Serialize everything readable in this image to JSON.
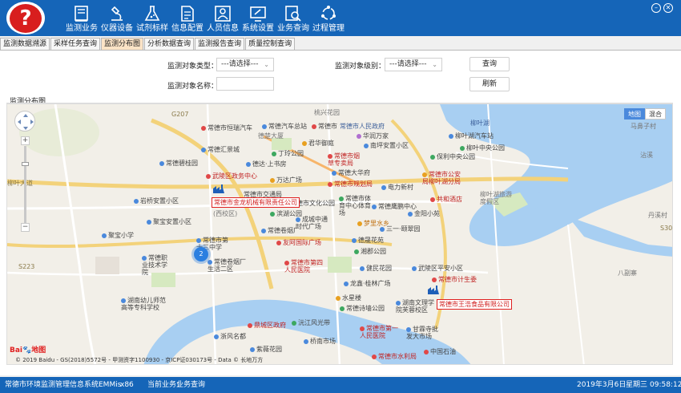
{
  "app": {
    "logo_char": "?",
    "window_min": "–",
    "window_close": "✕"
  },
  "toolbar": [
    {
      "label": "监测业务",
      "icon": "book-icon"
    },
    {
      "label": "仪器设备",
      "icon": "microscope-icon"
    },
    {
      "label": "试剂标样",
      "icon": "flask-icon"
    },
    {
      "label": "信息配置",
      "icon": "document-icon"
    },
    {
      "label": "人员信息",
      "icon": "person-card-icon"
    },
    {
      "label": "系统设置",
      "icon": "settings-screen-icon"
    },
    {
      "label": "业务查询",
      "icon": "search-doc-icon"
    },
    {
      "label": "过程管理",
      "icon": "cycle-icon"
    }
  ],
  "tabs": [
    {
      "label": "监测数据溯源",
      "active": false
    },
    {
      "label": "采样任务查询",
      "active": false
    },
    {
      "label": "监测分布图",
      "active": true
    },
    {
      "label": "分析数据查询",
      "active": false
    },
    {
      "label": "监测报告查询",
      "active": false
    },
    {
      "label": "质量控制查询",
      "active": false
    }
  ],
  "filters": {
    "type_label": "监测对象类型：",
    "type_value": "---请选择---",
    "level_label": "监测对象级别：",
    "level_value": "---请选择---",
    "name_label": "监测对象名称：",
    "name_value": "",
    "query_button": "查询",
    "refresh_button": "刷新"
  },
  "section_title": "监测分布图",
  "map": {
    "map_type": [
      "地图",
      "混合"
    ],
    "map_type_active": "地图",
    "cluster_count": "2",
    "companies": [
      "常德市金龙机械有限责任公司",
      "常德市王浩食品有限公司"
    ],
    "labels": {
      "l01": "桃兴花园",
      "l02": "常德市恒瑞汽车",
      "l03": "常德汽车总站",
      "l04": "常德市",
      "l05": "常德市人民政府",
      "l06": "德楚大厦",
      "l07": "南坪安置小区",
      "l08": "柳叶湖",
      "l09": "柳叶湖汽车站",
      "l10": "君华御庭",
      "l11": "华润万家",
      "l12": "常德汇景城",
      "l13": "丁玲公园",
      "l14": "常德市烟草专卖局",
      "l15": "柳叶中央公园",
      "l16": "保利中央公园",
      "l17": "常德碧桂园",
      "l18": "德达·上书房",
      "l19": "常德大华府",
      "l20": "武陵区政务中心",
      "l21": "万达广场",
      "l22": "常德市规划局",
      "l23": "电力新村",
      "l24": "常德市公安局柳叶湖分局",
      "l25": "柳叶湖旅游度假区",
      "l26": "常德市交通局",
      "l27": "岩桥安置小区",
      "l28": "常德市文化公园",
      "l29": "常德市体育中心体育场",
      "l30": "常德鹰鹏中心",
      "l31": "共和酒店",
      "l32": "聚宝安置小区",
      "l33": "(西校区)",
      "l34": "滨湖公园",
      "l35": "成城中通时代广场",
      "l36": "金阳小苑",
      "l37": "三一·颐翠园",
      "l38": "聚宝小学",
      "l39": "常德卷烟厂",
      "l40": "梦里水乡",
      "l41": "友阿国际广场",
      "l42": "德晟花苑",
      "l43": "湘郡公园",
      "l44": "常德市第十三中学",
      "l45": "常德卷烟厂生活二区",
      "l46": "常德职业技术学院",
      "l47": "常德市第四人民医院",
      "l48": "健民花园",
      "l49": "武陵区平安小区",
      "l50": "常德市计生委",
      "l51": "龙鑫·桂林广场",
      "l52": "常德诗墙公园",
      "l53": "水星楼",
      "l54": "湖南文理学院芙蓉校区",
      "l55": "鼎城区政府",
      "l56": "湖南幼儿师范高等专科学校",
      "l57": "沅江风光带",
      "l58": "常德市第一人民医院",
      "l59": "甘霖寺批发大市场",
      "l60": "常德市水利局",
      "l61": "浙风名都",
      "l62": "紫薇花园",
      "l63": "桥南市场",
      "l64": "中国石油",
      "l65": "马鼻子村",
      "l66": "沾溪",
      "l67": "丹溪村",
      "l68": "八副寨",
      "l69": "S301",
      "l70": "柳叶大道",
      "l71": "G207",
      "l72": "S223"
    },
    "baidu_logo": "Bai",
    "baidu_logo_b": "地图",
    "copyright": "© 2019 Baidu - GS(2018)5572号 - 甲测资字1100930 - 京ICP证030173号 - Data © 长地万方"
  },
  "status": {
    "system": "常德市环境监测管理信息系统EMMis",
    "arch": "x86",
    "current_label": "当前业务：",
    "current_value": "业务查询",
    "date": "2019年3月6日",
    "weekday": "星期三",
    "time": "09:58:12"
  }
}
